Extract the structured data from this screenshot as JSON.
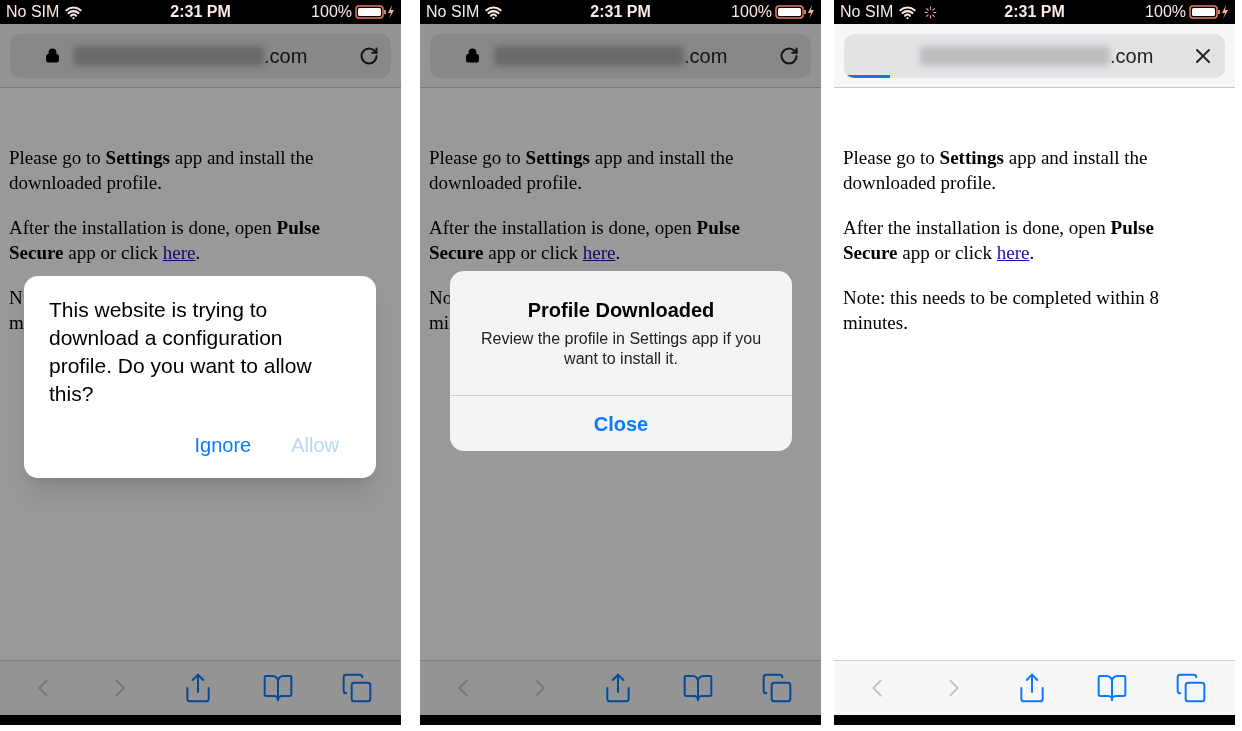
{
  "screens": [
    {
      "status_bar": {
        "carrier": "No SIM",
        "time": "2:31 PM",
        "battery": "100%",
        "activity": false
      },
      "address_bar": {
        "domain_suffix": ".com",
        "loading": false
      },
      "page": {
        "paragraphs": [
          {
            "text": "Please go to **Settings** app and install the downloaded profile."
          },
          {
            "text": "After the installation is done, open **Pulse Secure** app or click ",
            "link": "here",
            "after": "."
          },
          {
            "lines": [
              "N",
              "m"
            ]
          }
        ]
      },
      "dimmed": true,
      "dialog": {
        "kind": "permission",
        "message": "This website is trying to download a configuration profile. Do you want to allow this?",
        "buttons": [
          {
            "label": "Ignore",
            "disabled": false
          },
          {
            "label": "Allow",
            "disabled": true
          }
        ]
      },
      "toolbar": [
        {
          "kind": "back",
          "disabled": true
        },
        {
          "kind": "forward",
          "disabled": true
        },
        {
          "kind": "share",
          "disabled": false
        },
        {
          "kind": "bookmarks",
          "disabled": false
        },
        {
          "kind": "tabs",
          "disabled": false
        }
      ]
    },
    {
      "status_bar": {
        "carrier": "No SIM",
        "time": "2:31 PM",
        "battery": "100%",
        "activity": false
      },
      "address_bar": {
        "domain_suffix": ".com",
        "loading": false
      },
      "page": {
        "paragraphs": [
          {
            "text": "Please go to **Settings** app and install the downloaded profile."
          },
          {
            "text": "After the installation is done, open **Pulse Secure** app or click ",
            "link": "here",
            "after": "."
          },
          {
            "lines": [
              "No",
              "mi"
            ]
          }
        ]
      },
      "dimmed": true,
      "dialog": {
        "kind": "info",
        "title": "Profile Downloaded",
        "message": "Review the profile in Settings app if you want to install it.",
        "buttons": [
          {
            "label": "Close",
            "disabled": false
          }
        ]
      },
      "toolbar": [
        {
          "kind": "back",
          "disabled": true
        },
        {
          "kind": "forward",
          "disabled": true
        },
        {
          "kind": "share",
          "disabled": false
        },
        {
          "kind": "bookmarks",
          "disabled": false
        },
        {
          "kind": "tabs",
          "disabled": false
        }
      ]
    },
    {
      "status_bar": {
        "carrier": "No SIM",
        "time": "2:31 PM",
        "battery": "100%",
        "activity": true
      },
      "address_bar": {
        "domain_suffix": ".com",
        "loading": true,
        "level": 0.12
      },
      "page": {
        "paragraphs": [
          {
            "text": "Please go to **Settings** app and install the downloaded profile."
          },
          {
            "text": "After the installation is done, open **Pulse Secure** app or click ",
            "link": "here",
            "after": "."
          },
          {
            "text": "Note: this needs to be completed within 8 minutes."
          }
        ]
      },
      "dimmed": false,
      "toolbar": [
        {
          "kind": "back",
          "disabled": true
        },
        {
          "kind": "forward",
          "disabled": true
        },
        {
          "kind": "share",
          "disabled": false
        },
        {
          "kind": "bookmarks",
          "disabled": false
        },
        {
          "kind": "tabs",
          "disabled": false
        }
      ]
    }
  ]
}
